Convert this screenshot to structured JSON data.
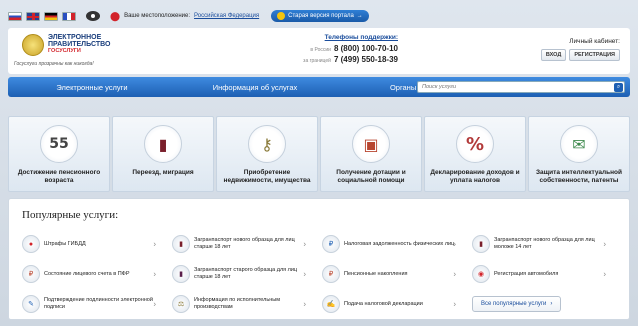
{
  "topbar": {
    "location_label": "Ваше местоположение:",
    "location_value": "Российская Федерация",
    "old_version_label": "Старая версия портала"
  },
  "header": {
    "logo_line1": "ЭЛЕКТРОННОЕ",
    "logo_line2": "ПРАВИТЕЛЬСТВО",
    "logo_line3": "ГОСУСЛУГИ",
    "slogan": "Госуслуги прозрачны как никогда!",
    "phones_title": "Телефоны поддержки:",
    "phones": [
      {
        "label": "в России",
        "number": "8 (800) 100-70-10"
      },
      {
        "label": "за границей",
        "number": "7 (499) 550-18-39"
      }
    ],
    "cabinet_title": "Личный кабинет:",
    "login_label": "ВХОД",
    "register_label": "РЕГИСТРАЦИЯ"
  },
  "nav": {
    "items": [
      "Электронные услуги",
      "Информация об услугах",
      "Органы власти"
    ],
    "search_placeholder": "Поиск услуги"
  },
  "categories": [
    {
      "label": "Достижение пенсионного возраста",
      "icon": "calendar-55-icon",
      "glyph": "55"
    },
    {
      "label": "Переезд, миграция",
      "icon": "passport-icon",
      "glyph": "▮"
    },
    {
      "label": "Приобретение недвижимости, имущества",
      "icon": "keys-icon",
      "glyph": "⚷"
    },
    {
      "label": "Получение дотации и социальной помощи",
      "icon": "package-icon",
      "glyph": "▣"
    },
    {
      "label": "Декларирование доходов и уплата налогов",
      "icon": "percent-icon",
      "glyph": "%"
    },
    {
      "label": "Защита интеллектуальной собственности, патенты",
      "icon": "certificate-icon",
      "glyph": "✉"
    }
  ],
  "popular": {
    "title": "Популярные услуги:",
    "services": [
      {
        "label": "Штрафы ГИБДД",
        "icon": "traffic-light-icon",
        "glyph": "●"
      },
      {
        "label": "Загранпаспорт нового образца для лиц старше 18 лет",
        "icon": "passport-icon",
        "glyph": "▮"
      },
      {
        "label": "Налоговая задолженность физических лиц",
        "icon": "tax-icon",
        "glyph": "₽"
      },
      {
        "label": "Загранпаспорт нового образца для лиц моложе 14 лет",
        "icon": "passport-child-icon",
        "glyph": "▮"
      },
      {
        "label": "Состояние лицевого счета в ПФР",
        "icon": "pension-account-icon",
        "glyph": "₽"
      },
      {
        "label": "Загранпаспорт старого образца для лиц старше 18 лет",
        "icon": "passport-old-icon",
        "glyph": "▮"
      },
      {
        "label": "Пенсионные накопления",
        "icon": "savings-icon",
        "glyph": "₽"
      },
      {
        "label": "Регистрация автомобиля",
        "icon": "car-icon",
        "glyph": "◉"
      },
      {
        "label": "Подтверждение подлинности электронной подписи",
        "icon": "signature-icon",
        "glyph": "✎"
      },
      {
        "label": "Информация по исполнительным производствам",
        "icon": "scales-icon",
        "glyph": "⚖"
      },
      {
        "label": "Подача налоговой декларации",
        "icon": "declaration-icon",
        "glyph": "✍"
      }
    ],
    "all_label": "Все популярные услуги"
  }
}
